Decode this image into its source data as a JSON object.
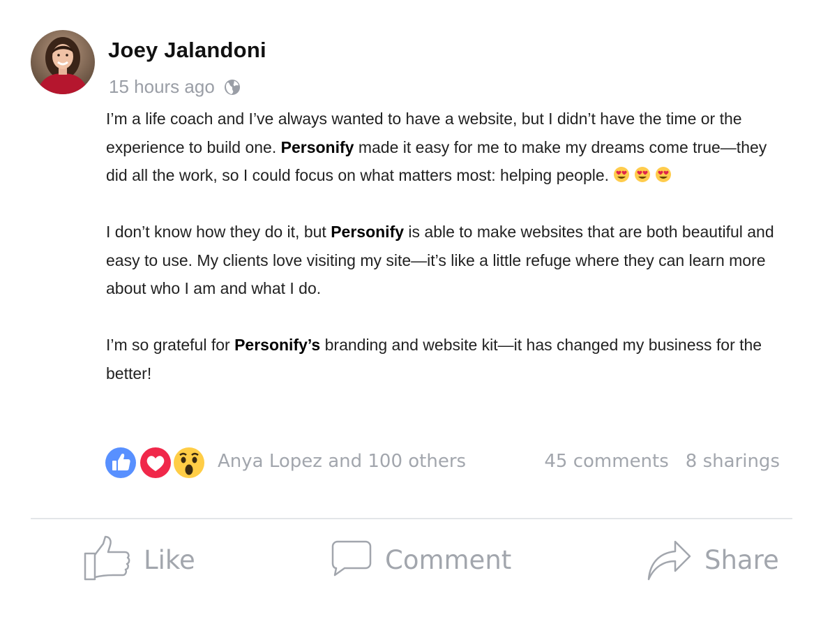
{
  "post": {
    "author": "Joey Jalandoni",
    "timestamp": "15 hours ago",
    "privacy_icon": "globe-icon",
    "paragraphs": [
      {
        "runs": [
          {
            "text": "I’m a life coach and I’ve always wanted to have a website, but I didn’t have the time or the experience to build one. ",
            "bold": false
          },
          {
            "text": "Personify",
            "bold": true
          },
          {
            "text": " made it easy for me to make my dreams come true—they did all the work, so I could focus on what matters most: helping people.",
            "bold": false
          }
        ],
        "emoji": [
          "heart-eyes-emoji",
          "heart-eyes-emoji",
          "heart-eyes-emoji"
        ]
      },
      {
        "runs": [
          {
            "text": "I don’t know how they do it, but ",
            "bold": false
          },
          {
            "text": "Personify",
            "bold": true
          },
          {
            "text": " is able to make websites that are both beautiful and easy to use. My clients love visiting my site—it’s like a little refuge where they can learn more about who I am and what I do.",
            "bold": false
          }
        ]
      },
      {
        "runs": [
          {
            "text": "I’m so grateful for ",
            "bold": false
          },
          {
            "text": "Personify’s",
            "bold": true
          },
          {
            "text": " branding and website kit—it has changed my business for the better!",
            "bold": false
          }
        ]
      }
    ],
    "reactions": {
      "icons": [
        "like-reaction-icon",
        "love-reaction-icon",
        "wow-reaction-icon"
      ],
      "reactors": "Anya Lopez and 100 others",
      "comments": "45 comments",
      "shares": "8 sharings"
    },
    "actions": {
      "like": "Like",
      "comment": "Comment",
      "share": "Share"
    }
  },
  "colors": {
    "muted": "#a2a6ad",
    "like_blue": "#5890ff",
    "love_red": "#f0284a",
    "wow_yellow": "#ffcd46",
    "divider": "#e3e5e8"
  }
}
